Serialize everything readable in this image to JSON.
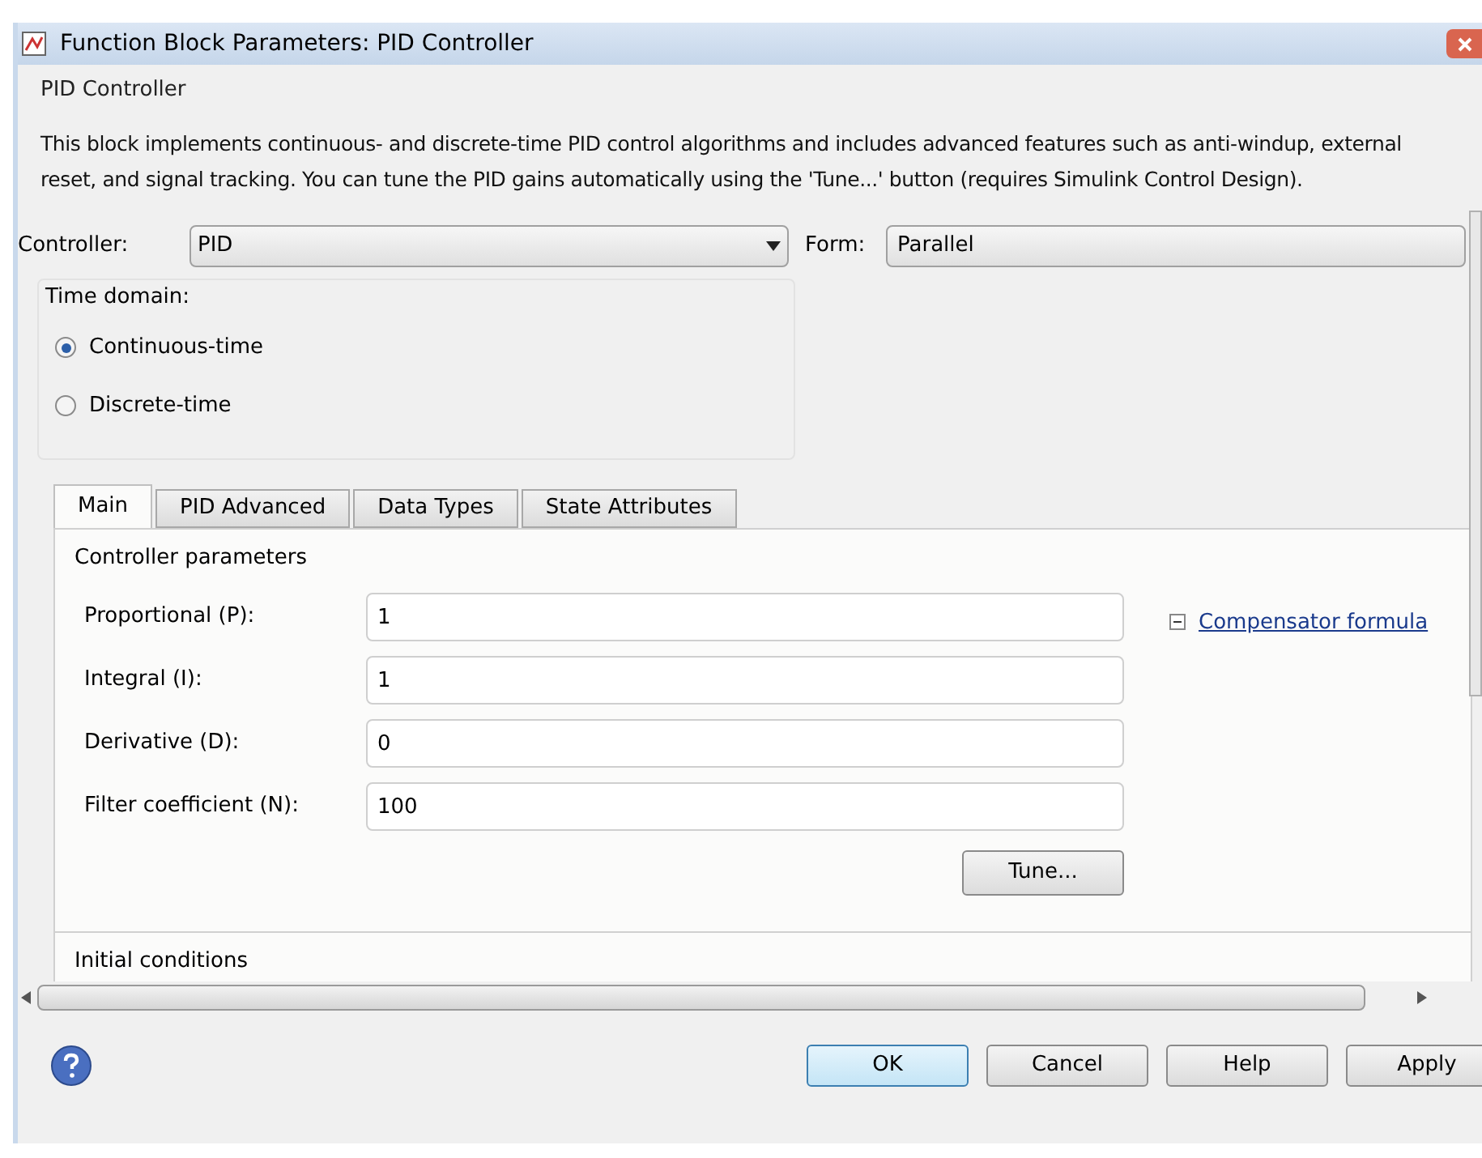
{
  "window": {
    "title": "Function Block Parameters: PID Controller"
  },
  "block": {
    "name": "PID Controller",
    "description": "This block implements continuous- and discrete-time PID control algorithms and includes advanced features such as anti-windup, external reset, and signal tracking. You can tune the PID gains automatically using the 'Tune...' button (requires Simulink Control Design)."
  },
  "controller": {
    "label": "Controller:",
    "value": "PID"
  },
  "form": {
    "label": "Form:",
    "value": "Parallel"
  },
  "time_domain": {
    "label": "Time domain:",
    "options": [
      {
        "label": "Continuous-time",
        "selected": true
      },
      {
        "label": "Discrete-time",
        "selected": false
      }
    ]
  },
  "tabs": [
    {
      "label": "Main",
      "selected": true
    },
    {
      "label": "PID Advanced",
      "selected": false
    },
    {
      "label": "Data Types",
      "selected": false
    },
    {
      "label": "State Attributes",
      "selected": false
    }
  ],
  "controller_parameters": {
    "label": "Controller parameters",
    "fields": [
      {
        "label": "Proportional (P):",
        "value": "1"
      },
      {
        "label": "Integral (I):",
        "value": "1"
      },
      {
        "label": "Derivative (D):",
        "value": "0"
      },
      {
        "label": "Filter coefficient (N):",
        "value": "100"
      }
    ],
    "link": "Compensator formula",
    "tune_button": "Tune..."
  },
  "initial_conditions": {
    "label": "Initial conditions"
  },
  "buttons": [
    {
      "label": "OK",
      "kind": "default"
    },
    {
      "label": "Cancel",
      "kind": "normal"
    },
    {
      "label": "Help",
      "kind": "normal"
    },
    {
      "label": "Apply",
      "kind": "normal"
    }
  ]
}
